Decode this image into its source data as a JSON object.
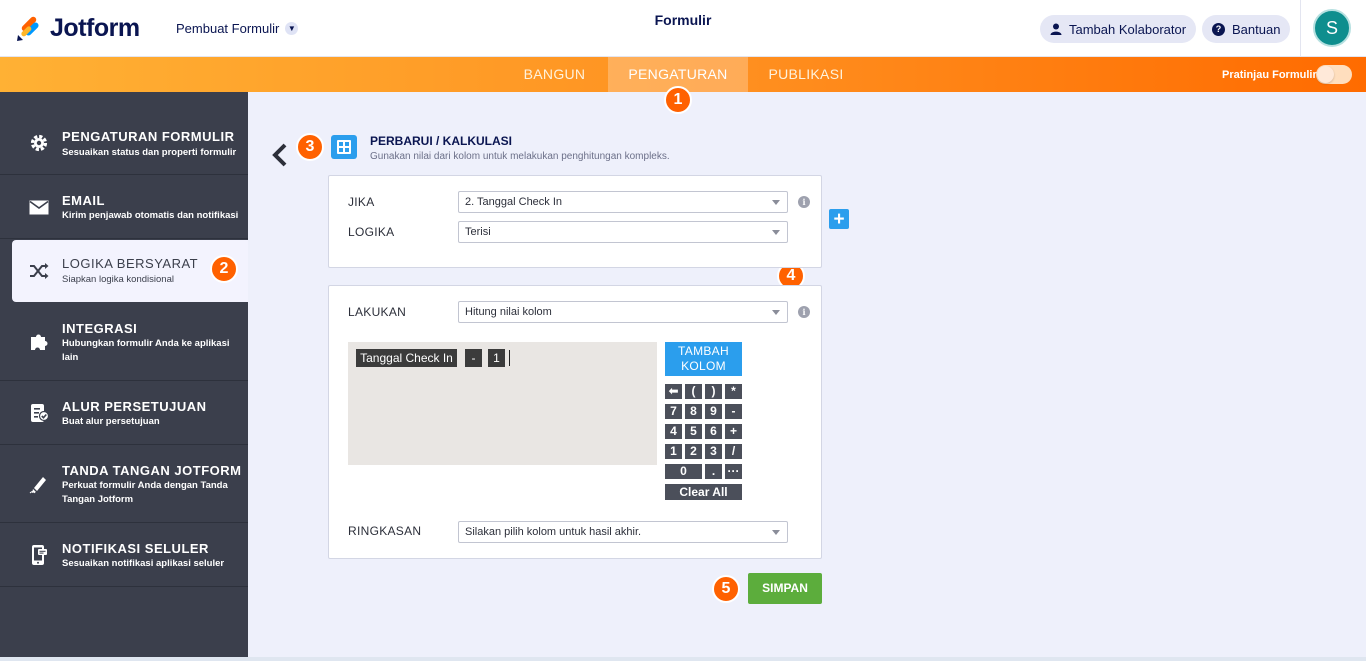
{
  "header": {
    "logo_text": "Jotform",
    "form_builder_label": "Pembuat Formulir",
    "page_title": "Formulir",
    "add_collaborator_label": "Tambah Kolaborator",
    "help_label": "Bantuan",
    "avatar_initial": "S"
  },
  "nav": {
    "tabs": [
      {
        "label": "BANGUN",
        "active": false
      },
      {
        "label": "PENGATURAN",
        "active": true
      },
      {
        "label": "PUBLIKASI",
        "active": false
      }
    ],
    "preview_label": "Pratinjau Formulir",
    "preview_enabled": false
  },
  "sidebar": {
    "items": [
      {
        "title": "PENGATURAN FORMULIR",
        "desc": "Sesuaikan status dan properti formulir",
        "icon": "gear-icon"
      },
      {
        "title": "EMAIL",
        "desc": "Kirim penjawab otomatis dan notifikasi",
        "icon": "envelope-icon"
      },
      {
        "title": "LOGIKA BERSYARAT",
        "desc": "Siapkan logika kondisional",
        "icon": "shuffle-icon",
        "active": true
      },
      {
        "title": "INTEGRASI",
        "desc": "Hubungkan formulir Anda ke aplikasi lain",
        "icon": "puzzle-icon"
      },
      {
        "title": "ALUR PERSETUJUAN",
        "desc": "Buat alur persetujuan",
        "icon": "approval-icon"
      },
      {
        "title": "TANDA TANGAN JOTFORM",
        "desc": "Perkuat formulir Anda dengan Tanda Tangan Jotform",
        "icon": "pen-icon"
      },
      {
        "title": "NOTIFIKASI SELULER",
        "desc": "Sesuaikan notifikasi aplikasi seluler",
        "icon": "mobile-icon"
      }
    ]
  },
  "badges": [
    "1",
    "2",
    "3",
    "4",
    "5"
  ],
  "condition": {
    "title": "PERBARUI / KALKULASI",
    "subtitle": "Gunakan nilai dari kolom untuk melakukan penghitungan kompleks.",
    "if_label": "JIKA",
    "if_value": "2. Tanggal Check In",
    "logic_label": "LOGIKA",
    "logic_value": "Terisi",
    "do_label": "LAKUKAN",
    "do_value": "Hitung nilai kolom",
    "tokens": [
      "Tanggal Check In",
      "-",
      "1"
    ],
    "add_field_label": "TAMBAH KOLOM",
    "keypad": [
      [
        "⬅",
        "(",
        ")",
        "*"
      ],
      [
        "7",
        "8",
        "9",
        "-"
      ],
      [
        "4",
        "5",
        "6",
        "+"
      ],
      [
        "1",
        "2",
        "3",
        "/"
      ],
      [
        "0",
        ".",
        "···"
      ]
    ],
    "clear_label": "Clear All",
    "result_label": "RINGKASAN",
    "result_placeholder": "Silakan pilih kolom untuk hasil akhir."
  },
  "save_label": "SIMPAN",
  "colors": {
    "accent_orange": "#ff6100",
    "blue": "#2b9eed",
    "green": "#5cad3c",
    "sidebar": "#3b3f4c"
  }
}
